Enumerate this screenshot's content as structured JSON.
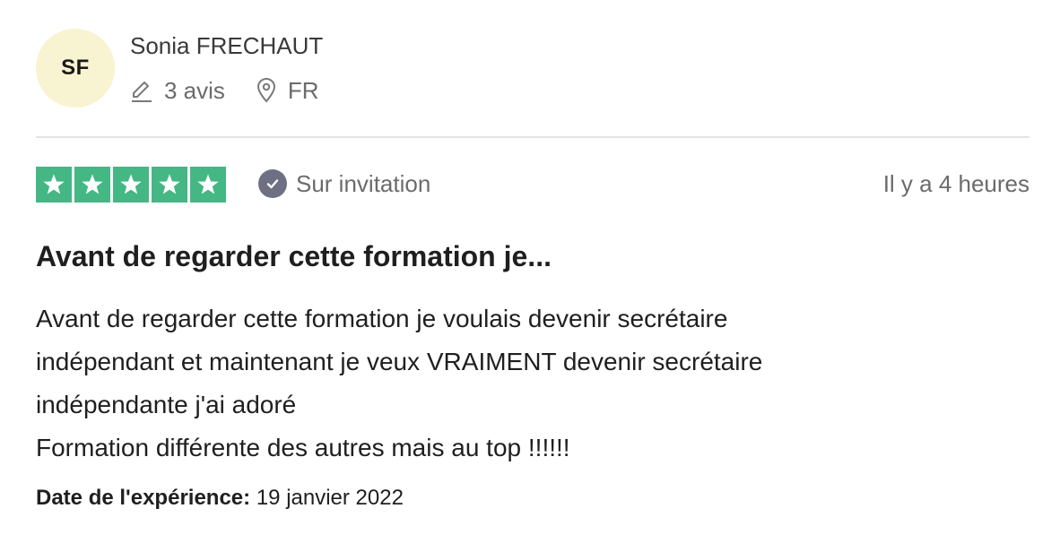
{
  "reviewer": {
    "initials": "SF",
    "name": "Sonia FRECHAUT",
    "review_count": "3 avis",
    "country": "FR"
  },
  "review": {
    "rating": 5,
    "star_color": "#44b784",
    "invitation_label": "Sur invitation",
    "time_ago": "Il y a 4 heures",
    "title": "Avant de regarder cette formation je...",
    "body_lines": [
      "Avant de regarder cette formation je voulais devenir secrétaire",
      "indépendant et maintenant je veux VRAIMENT devenir secrétaire",
      "indépendante j'ai adoré",
      "Formation différente des autres mais au top !!!!!!"
    ],
    "experience_label": "Date de l'expérience:",
    "experience_date": "19 janvier 2022"
  },
  "icons": {
    "review_count": "pencil-icon",
    "country": "location-pin-icon",
    "invitation": "check-circle-icon",
    "rating": "star-icon"
  }
}
